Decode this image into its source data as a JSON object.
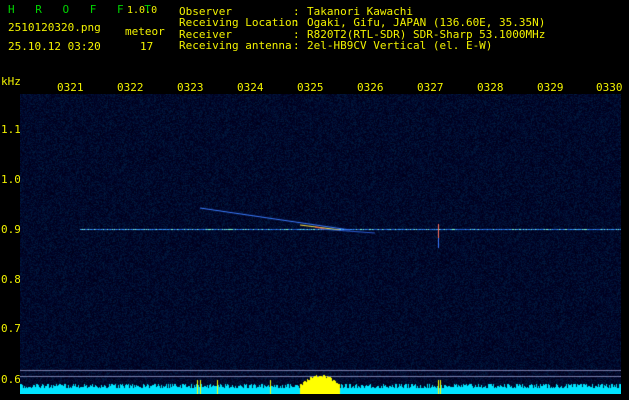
{
  "app": {
    "title": "H R O F F T",
    "version": "1.0.0"
  },
  "file": {
    "name": "2510120320.png",
    "datetime": "25.10.12 03:20"
  },
  "meteor": {
    "label": "meteor",
    "count": "17"
  },
  "info": [
    {
      "label": "Observer",
      "value": "Takanori Kawachi"
    },
    {
      "label": "Receiving Location",
      "value": "Ogaki, Gifu, JAPAN (136.60E, 35.35N)"
    },
    {
      "label": "Receiver",
      "value": "R820T2(RTL-SDR) SDR-Sharp 53.1000MHz"
    },
    {
      "label": "Receiving antenna",
      "value": "2el-HB9CV Vertical (el. E-W)"
    }
  ],
  "axes": {
    "y_unit": "kHz",
    "y_ticks": [
      "1.1",
      "1.0",
      "0.9",
      "0.8",
      "0.7",
      "0.6"
    ],
    "x_ticks": [
      "0321",
      "0322",
      "0323",
      "0324",
      "0325",
      "0326",
      "0327",
      "0328",
      "0329",
      "0330"
    ]
  },
  "colors": {
    "text": "#f2f200",
    "title": "#00d400",
    "background": "#000000",
    "waterfall_bg": "#000018",
    "noise_floor": "#00e5ff",
    "burst": "#ffff00"
  }
}
